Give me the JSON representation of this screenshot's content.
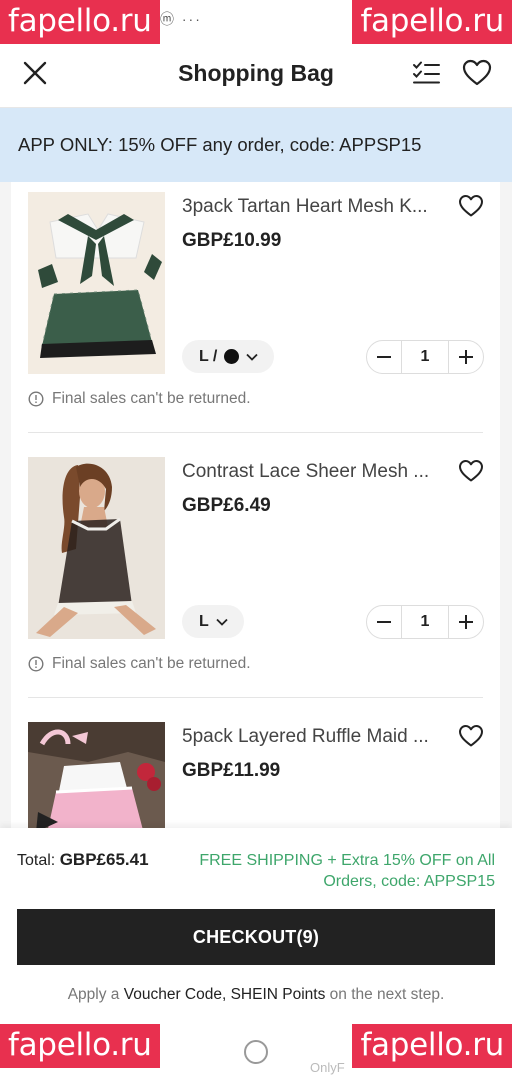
{
  "watermarks": [
    "fapello.ru",
    "fapello.ru",
    "fapello.ru",
    "fapello.ru"
  ],
  "status_bar": {
    "icons": "ⓜ ···"
  },
  "header": {
    "title": "Shopping Bag"
  },
  "promo_banner": {
    "text": "APP ONLY: 15% OFF any order, code: APPSP15"
  },
  "items": [
    {
      "title": "3pack Tartan Heart Mesh K...",
      "price": "GBP£10.99",
      "size": "L /",
      "has_color_dot": true,
      "quantity": "1",
      "notice": "Final sales can't be returned."
    },
    {
      "title": "Contrast Lace Sheer Mesh ...",
      "price": "GBP£6.49",
      "size": "L",
      "has_color_dot": false,
      "quantity": "1",
      "notice": "Final sales can't be returned."
    },
    {
      "title": "5pack Layered Ruffle Maid ...",
      "price": "GBP£11.99"
    }
  ],
  "footer": {
    "total_label": "Total:",
    "total_value": "GBP£65.41",
    "shipping_line1": "FREE SHIPPING + Extra 15% OFF on All",
    "shipping_line2": "Orders, code: APPSP15",
    "checkout_label": "CHECKOUT(9)",
    "apply_prefix": "Apply a",
    "apply_voucher": "Voucher Code, SHEIN Points",
    "apply_suffix": "on the next step."
  },
  "nav_bar": {
    "overlay_text": "OnlyF"
  },
  "colors": {
    "promo_bg": "#d7e8f8",
    "checkout_bg": "#222222",
    "shipping_text": "#3ea66b",
    "watermark_bg": "#e8304f"
  }
}
